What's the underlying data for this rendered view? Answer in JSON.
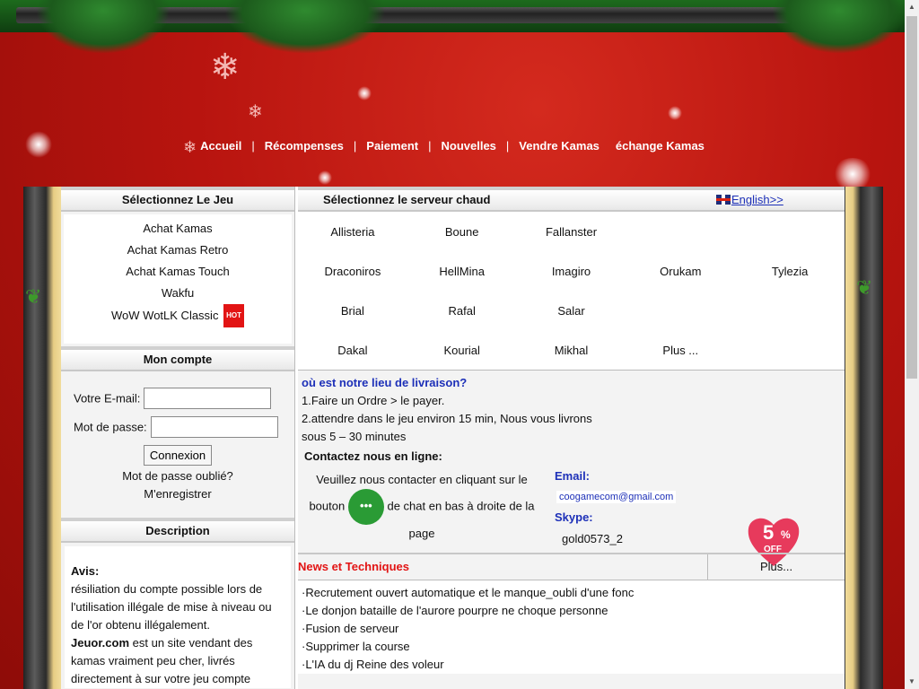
{
  "nav": {
    "items": [
      "Accueil",
      "Récompenses",
      "Paiement",
      "Nouvelles",
      "Vendre Kamas",
      "échange Kamas"
    ],
    "sep": "|"
  },
  "left": {
    "games_title": "Sélectionnez Le Jeu",
    "games": [
      "Achat Kamas",
      "Achat Kamas Retro",
      "Achat Kamas Touch",
      "Wakfu",
      "WoW WotLK Classic"
    ],
    "hot_badge": "HOT",
    "account_title": "Mon compte",
    "email_label": "Votre E-mail:",
    "password_label": "Mot de passe:",
    "login_button": "Connexion",
    "forgot": "Mot de passe oublié?",
    "register": "M'enregistrer",
    "desc_title": "Description",
    "desc_notice": "Avis:",
    "desc_text": "résiliation du compte possible lors de l'utilisation illégale de mise à niveau ou de l'or obtenu illégalement.",
    "desc_brand": "Jeuor.com",
    "desc_text2": " est un site vendant des kamas vraiment peu cher, livrés directement à sur votre jeu compte"
  },
  "right": {
    "server_title": "Sélectionnez le serveur chaud",
    "lang_link": "English>>",
    "servers": [
      [
        "Allisteria",
        "Boune",
        "Fallanster",
        "",
        ""
      ],
      [
        "Draconiros",
        "HellMina",
        "Imagiro",
        "Orukam",
        "Tylezia"
      ],
      [
        "Brial",
        "Rafal",
        "Salar",
        "",
        ""
      ],
      [
        "Dakal",
        "Kourial",
        "Mikhal",
        "Plus ...",
        ""
      ]
    ],
    "delivery_q": "où est notre lieu de livraison?",
    "step1": "1.Faire un Ordre > le payer.",
    "step2": "2.attendre dans le jeu environ 15 min, Nous vous livrons sous 5 – 30 minutes",
    "contact_title": "Contactez nous en ligne:",
    "contact_text1": "Veuillez nous contacter en cliquant sur le bouton",
    "contact_text2": "de chat en bas à droite de la page",
    "email_label": "Email:",
    "email_value": "coogamecom@gmail.com",
    "skype_label": "Skype:",
    "skype_value": "gold0573_2",
    "promo_number": "5",
    "promo_unit": "%",
    "promo_text": "OFF",
    "news_title": "News et Techniques",
    "news_more": "Plus...",
    "news": [
      "·Recrutement ouvert automatique et le manque_oubli d'une fonc",
      "·Le donjon bataille de l'aurore pourpre ne choque personne",
      "·Fusion de serveur",
      "·Supprimer la course",
      "·L'IA du dj Reine des voleur"
    ]
  }
}
